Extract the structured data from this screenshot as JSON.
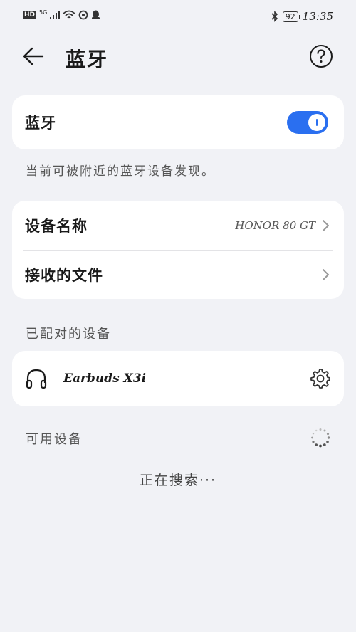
{
  "status_bar": {
    "hd": "HD",
    "signal_label": "5G",
    "battery": "92",
    "time": "13:35"
  },
  "header": {
    "title": "蓝牙"
  },
  "bluetooth_toggle": {
    "label": "蓝牙",
    "state": "on",
    "accent": "#2a6ff0"
  },
  "visibility_note": "当前可被附近的蓝牙设备发现。",
  "settings": {
    "device_name_label": "设备名称",
    "device_name_value": "HONOR 80 GT",
    "received_files_label": "接收的文件"
  },
  "paired": {
    "section_title": "已配对的设备",
    "devices": [
      {
        "name": "Earbuds X3i",
        "icon": "headphones-icon"
      }
    ]
  },
  "available": {
    "section_title": "可用设备",
    "searching_text": "正在搜索···"
  }
}
